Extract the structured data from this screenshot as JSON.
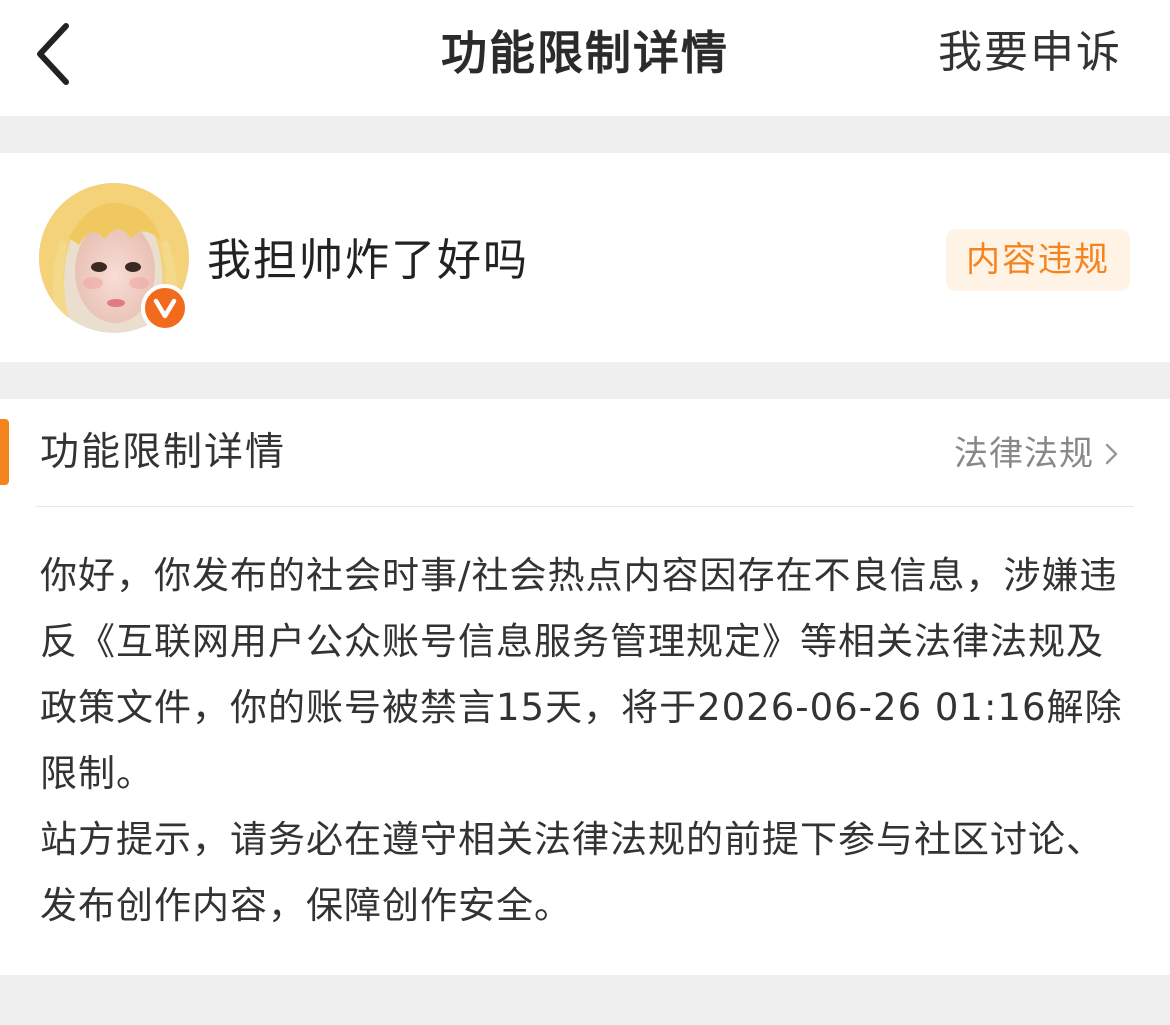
{
  "header": {
    "title": "功能限制详情",
    "appeal_label": "我要申诉",
    "back_icon": "chevron-left-icon"
  },
  "user": {
    "name": "我担帅炸了好吗",
    "verified_badge": "V",
    "tag": "内容违规"
  },
  "details": {
    "section_title": "功能限制详情",
    "law_link": "法律法规",
    "paragraphs": [
      "你好，你发布的社会时事/社会热点内容因存在不良信息，涉嫌违反《互联网用户公众账号信息服务管理规定》等相关法律法规及政策文件，你的账号被禁言15天，将于2026-06-26 01:16解除限制。",
      "站方提示，请务必在遵守相关法律法规的前提下参与社区讨论、发布创作内容，保障创作安全。"
    ]
  },
  "colors": {
    "accent": "#f5841f",
    "badge": "#f26a1b",
    "tag_bg": "#fff3e6",
    "page_bg": "#efefef"
  }
}
